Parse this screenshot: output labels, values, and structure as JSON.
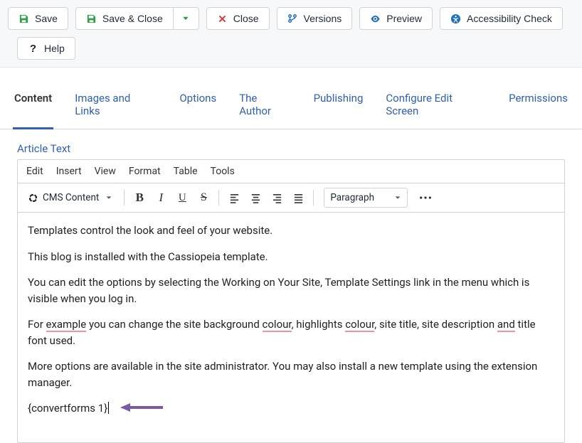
{
  "toolbar": {
    "save": "Save",
    "save_close": "Save & Close",
    "close": "Close",
    "versions": "Versions",
    "preview": "Preview",
    "accessibility": "Accessibility Check",
    "help": "Help"
  },
  "tabs": [
    {
      "id": "content",
      "label": "Content",
      "active": true
    },
    {
      "id": "images",
      "label": "Images and Links",
      "active": false
    },
    {
      "id": "options",
      "label": "Options",
      "active": false
    },
    {
      "id": "author",
      "label": "The Author",
      "active": false
    },
    {
      "id": "publishing",
      "label": "Publishing",
      "active": false
    },
    {
      "id": "configure",
      "label": "Configure Edit Screen",
      "active": false
    },
    {
      "id": "permissions",
      "label": "Permissions",
      "active": false
    }
  ],
  "editor": {
    "field_label": "Article Text",
    "menus": [
      "Edit",
      "Insert",
      "View",
      "Format",
      "Table",
      "Tools"
    ],
    "cms_label": "CMS Content",
    "block_format": "Paragraph",
    "paragraphs": [
      "Templates control the look and feel of your website.",
      "This blog is installed with the Cassiopeia template.",
      "You can edit the options by selecting the Working on Your Site, Template Settings link in the menu which is visible when you log in.",
      {
        "parts": [
          {
            "t": "For "
          },
          {
            "t": "example",
            "spell": true
          },
          {
            "t": " you can change the site background "
          },
          {
            "t": "colour",
            "spell": true
          },
          {
            "t": ", highlights "
          },
          {
            "t": "colour",
            "spell": true
          },
          {
            "t": ", site title, site description "
          },
          {
            "t": "and",
            "spell": true
          },
          {
            "t": " title font used."
          }
        ]
      },
      "More options are available in the site administrator. You may also install a new template using the extension manager.",
      {
        "shortcode": "{convertforms 1}",
        "caret": true,
        "arrow": true
      }
    ]
  },
  "colors": {
    "accent": "#2f61b0",
    "save_icon": "#2f9e44",
    "close_icon": "#d63a3a",
    "preview_icon": "#1c6fbf",
    "access_icon": "#1c6fbf",
    "annot_arrow": "#7a5aa8"
  }
}
